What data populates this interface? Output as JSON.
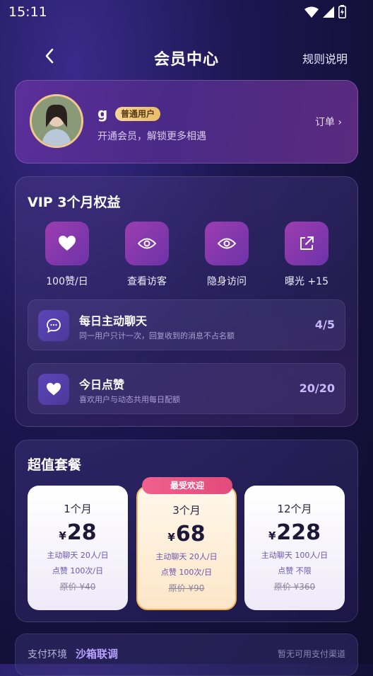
{
  "status_bar": {
    "time": "15:11"
  },
  "header": {
    "title": "会员中心",
    "rules_link": "规则说明"
  },
  "profile": {
    "username": "g",
    "badge": "普通用户",
    "subtitle": "开通会员，解锁更多相遇",
    "orders_link": "订单 ›"
  },
  "vip": {
    "title": "VIP 3个月权益",
    "perks": [
      {
        "icon": "heart-icon",
        "label": "100赞/日"
      },
      {
        "icon": "eye-icon",
        "label": "查看访客"
      },
      {
        "icon": "eye-icon",
        "label": "隐身访问"
      },
      {
        "icon": "share-icon",
        "label": "曝光 +15"
      }
    ],
    "quotas": [
      {
        "icon": "chat-icon",
        "title": "每日主动聊天",
        "subtitle": "同一用户只计一次，回复收到的消息不占名额",
        "count": "4/5"
      },
      {
        "icon": "heart-icon",
        "title": "今日点赞",
        "subtitle": "喜欢用户与动态共用每日配额",
        "count": "20/20"
      }
    ]
  },
  "plans": {
    "title": "超值套餐",
    "hot_tag": "最受欢迎",
    "items": [
      {
        "period": "1个月",
        "currency": "¥",
        "price": "28",
        "chat": "主动聊天 20人/日",
        "likes": "点赞 100次/日",
        "original": "原价 ¥40"
      },
      {
        "period": "3个月",
        "currency": "¥",
        "price": "68",
        "chat": "主动聊天 20人/日",
        "likes": "点赞 100次/日",
        "original": "原价 ¥90"
      },
      {
        "period": "12个月",
        "currency": "¥",
        "price": "228",
        "chat": "主动聊天 100人/日",
        "likes": "点赞 不限",
        "original": "原价 ¥360"
      }
    ]
  },
  "payment": {
    "label": "支付环境",
    "value": "沙箱联调",
    "note": "暂无可用支付渠道"
  },
  "colors": {
    "accent": "#b8a0ff",
    "badge_gold": "#f6d596",
    "hot_pink": "#e24b7c"
  }
}
